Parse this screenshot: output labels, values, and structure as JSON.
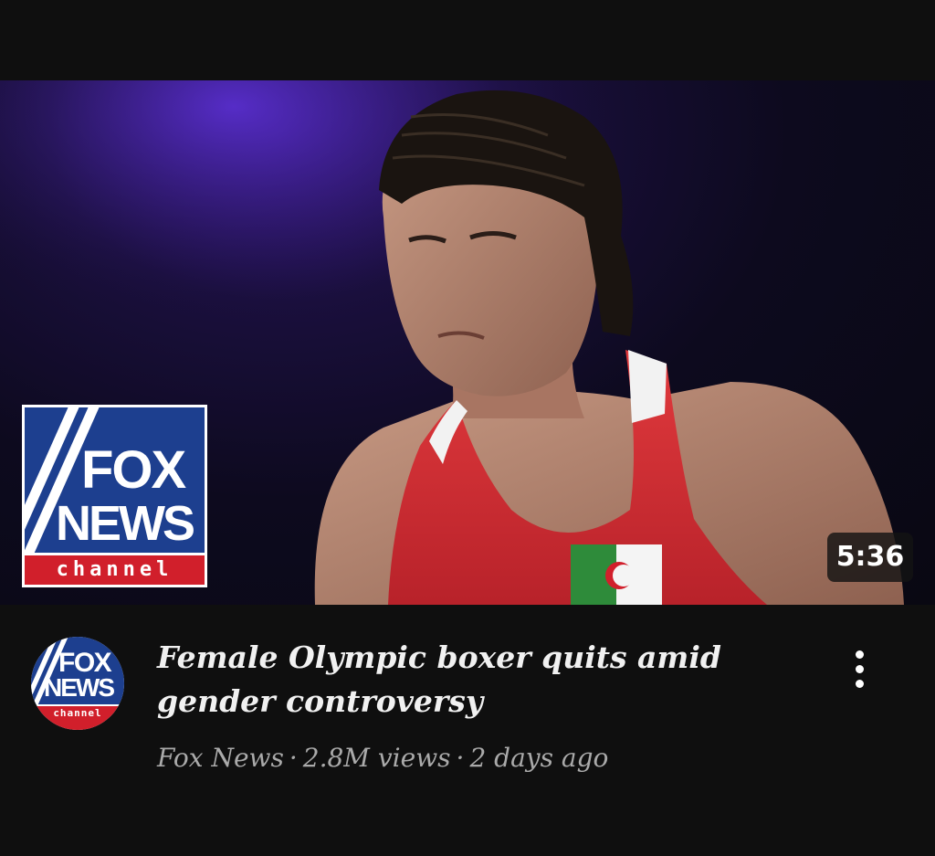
{
  "video": {
    "duration": "5:36",
    "title": "Female Olympic boxer quits amid gender controversy",
    "channel": "Fox News",
    "separator": "·",
    "views": "2.8M views",
    "age": "2 days ago"
  },
  "thumbnail_logo": {
    "line1": "FOX",
    "line2": "NEWS",
    "line3": "channel"
  },
  "avatar_logo": {
    "line1": "FOX",
    "line2": "NEWS",
    "line3": "channel"
  },
  "icons": {
    "more": "more-vert-icon"
  },
  "colors": {
    "background": "#0f0f0f",
    "title_text": "#f1f1f1",
    "meta_text": "#aaaaaa",
    "fox_blue": "#1d3f8f",
    "fox_red": "#d11f2b"
  }
}
